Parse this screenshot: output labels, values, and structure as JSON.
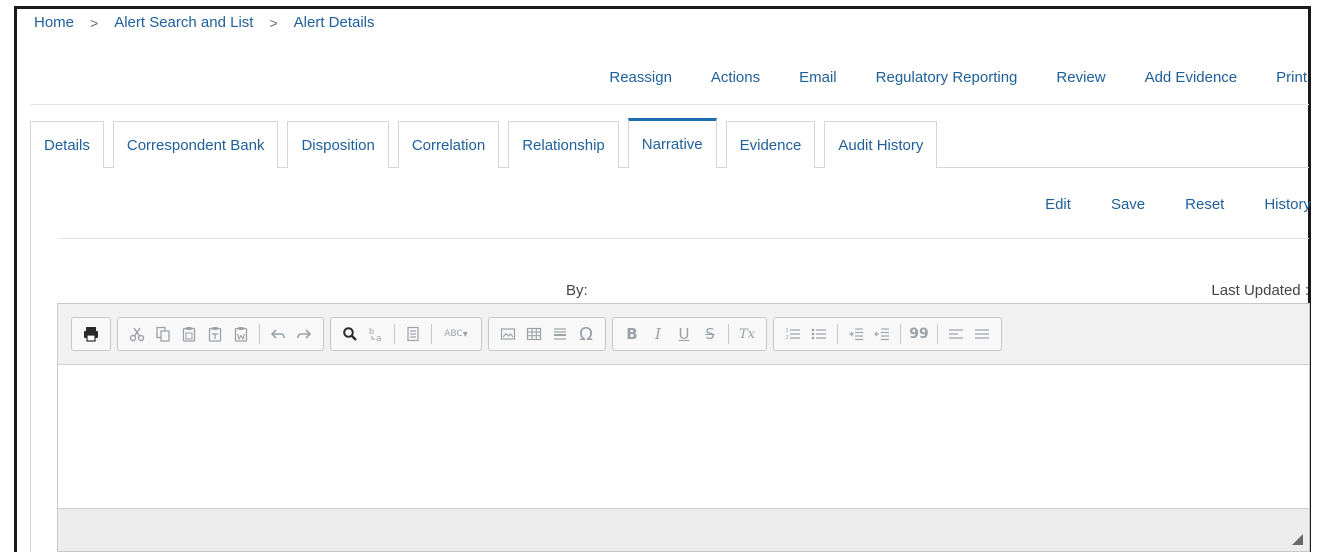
{
  "breadcrumb": {
    "items": [
      "Home",
      "Alert Search and List",
      "Alert Details"
    ],
    "separator": ">"
  },
  "actions": [
    "Reassign",
    "Actions",
    "Email",
    "Regulatory Reporting",
    "Review",
    "Add Evidence",
    "Print"
  ],
  "tabs": {
    "items": [
      "Details",
      "Correspondent Bank",
      "Disposition",
      "Correlation",
      "Relationship",
      "Narrative",
      "Evidence",
      "Audit History"
    ],
    "active": "Narrative"
  },
  "narrative": {
    "sub_actions": [
      "Edit",
      "Save",
      "Reset",
      "History"
    ],
    "by_label": "By:",
    "last_updated_label": "Last Updated :"
  },
  "editor": {
    "toolbar_icons": [
      "print-icon",
      "cut-icon",
      "copy-icon",
      "paste-icon",
      "paste-text-icon",
      "paste-word-icon",
      "undo-icon",
      "redo-icon",
      "find-icon",
      "replace-icon",
      "select-all-icon",
      "spellcheck-icon",
      "image-icon",
      "table-icon",
      "horizontal-line-icon",
      "special-char-icon",
      "bold-icon",
      "italic-icon",
      "underline-icon",
      "strike-icon",
      "remove-format-icon",
      "numbered-list-icon",
      "bulleted-list-icon",
      "outdent-icon",
      "indent-icon",
      "blockquote-icon",
      "align-left-icon"
    ],
    "spellcheck_text": "ABC",
    "bold_text": "B",
    "italic_text": "I",
    "underline_text": "U",
    "strike_text": "S",
    "remove_format_text": "Tx",
    "blockquote_text": "99",
    "special_char_text": "Ω"
  },
  "colors": {
    "link": "#1f5f9a",
    "active_tab_border": "#1f6fb0",
    "toolbar_bg": "#f1f1f1"
  }
}
